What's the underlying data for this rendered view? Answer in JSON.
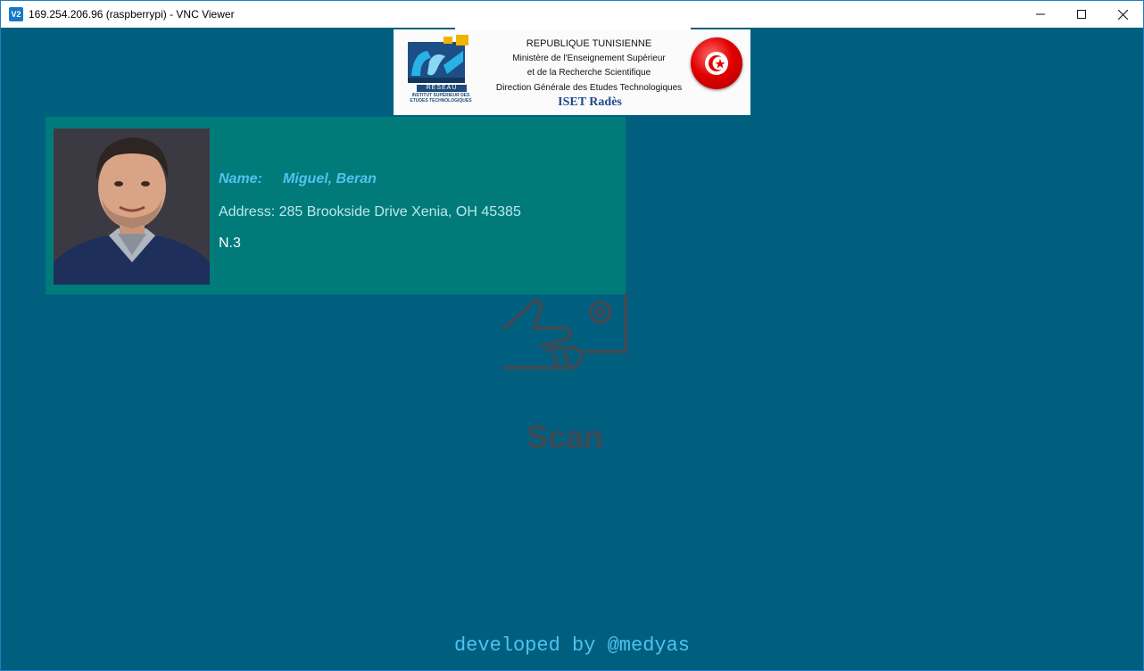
{
  "window": {
    "app_icon_text": "V2",
    "title": "169.254.206.96 (raspberrypi) - VNC Viewer",
    "minimize_symbol": "—",
    "maximize_symbol": "☐",
    "close_symbol": "✕"
  },
  "banner": {
    "iset_reseau": "RESEAU",
    "iset_subtitle": "INSTITUT SUPÉRIEUR DES ETUDES TECHNOLOGIQUES",
    "lines": [
      "REPUBLIQUE TUNISIENNE",
      "Ministère de l'Enseignement Supérieur",
      "et de la Recherche Scientifique",
      "Direction Générale des Etudes Technologiques"
    ],
    "institute": "ISET Radès"
  },
  "person": {
    "name_label": "Name:",
    "name_value": "Miguel, Beran",
    "address": "Address: 285 Brookside Drive Xenia, OH 45385",
    "number": "N.3"
  },
  "scan": {
    "label": "Scan",
    "icon": "hand-card-scan-icon"
  },
  "footer": {
    "text": "developed by @medyas"
  },
  "colors": {
    "background": "#005f7f",
    "card": "#017b7a",
    "name_text": "#51c2ee",
    "footer_text": "#4fc3ef",
    "scan_icon": "#3e4a55"
  }
}
